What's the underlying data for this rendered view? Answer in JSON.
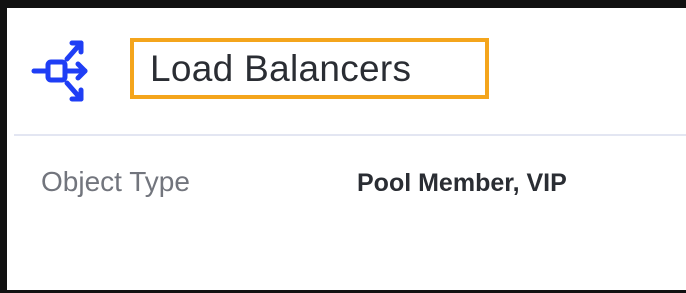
{
  "header": {
    "icon": "load-balancer-icon",
    "title": "Load Balancers",
    "icon_color": "#1f3ef5",
    "highlight_color": "#f4a51c"
  },
  "details": {
    "object_type_label": "Object Type",
    "object_type_value": "Pool Member, VIP"
  }
}
